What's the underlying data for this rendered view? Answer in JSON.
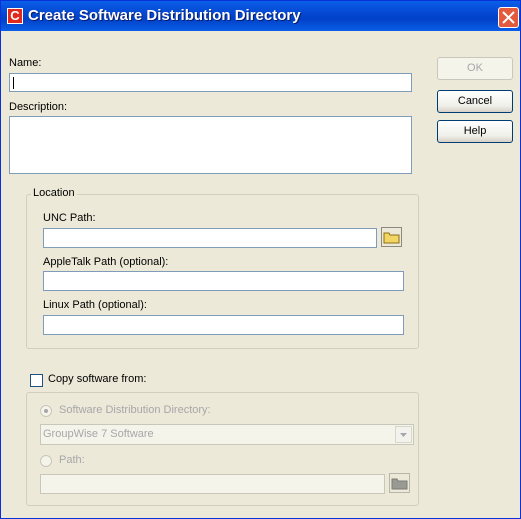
{
  "window": {
    "title": "Create Software Distribution Directory"
  },
  "fields": {
    "name_label": "Name:",
    "name_value": "",
    "description_label": "Description:",
    "description_value": ""
  },
  "buttons": {
    "ok": "OK",
    "cancel": "Cancel",
    "help": "Help"
  },
  "location": {
    "legend": "Location",
    "unc_label": "UNC Path:",
    "unc_value": "",
    "appletalk_label": "AppleTalk Path (optional):",
    "appletalk_value": "",
    "linux_label": "Linux Path (optional):",
    "linux_value": ""
  },
  "copy": {
    "checkbox_label": "Copy software from:",
    "checked": false,
    "option_sdd_label": "Software Distribution Directory:",
    "sdd_selected": "GroupWise 7 Software",
    "option_path_label": "Path:",
    "path_value": ""
  },
  "colors": {
    "title_bar": "#0548D2",
    "dialog_bg": "#ECE9D8",
    "close_button": "#E35A3C",
    "disabled_text": "#A7A6AA",
    "folder_yellow": "#F2D563"
  },
  "icons": [
    "app-icon",
    "close-icon",
    "folder-icon",
    "chevron-down-icon"
  ]
}
